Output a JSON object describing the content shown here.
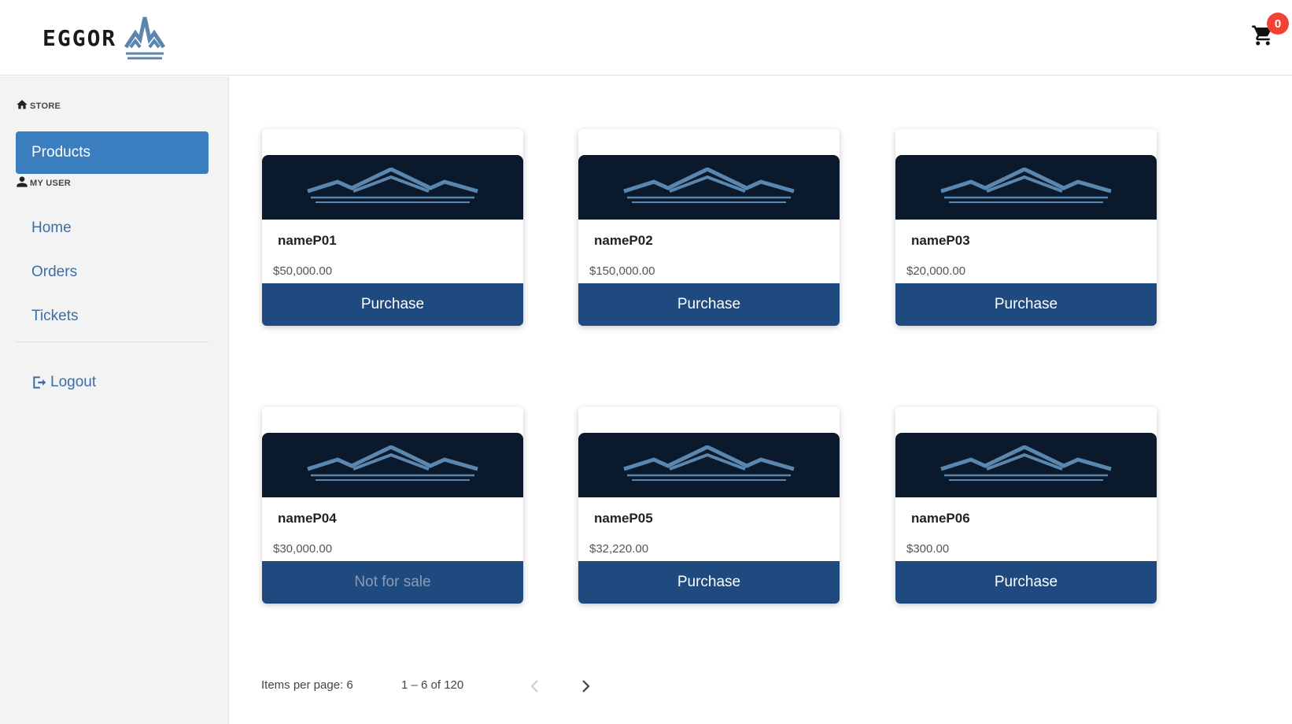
{
  "header": {
    "logo_text": "EGGOR",
    "cart_count": "0"
  },
  "sidebar": {
    "store_heading": "STORE",
    "products_label": "Products",
    "my_user_heading": "MY USER",
    "home_label": "Home",
    "orders_label": "Orders",
    "tickets_label": "Tickets",
    "logout_label": "Logout"
  },
  "products": [
    {
      "name": "nameP01",
      "price": "$50,000.00",
      "action": "Purchase",
      "for_sale": true
    },
    {
      "name": "nameP02",
      "price": "$150,000.00",
      "action": "Purchase",
      "for_sale": true
    },
    {
      "name": "nameP03",
      "price": "$20,000.00",
      "action": "Purchase",
      "for_sale": true
    },
    {
      "name": "nameP04",
      "price": "$30,000.00",
      "action": "Not for sale",
      "for_sale": false
    },
    {
      "name": "nameP05",
      "price": "$32,220.00",
      "action": "Purchase",
      "for_sale": true
    },
    {
      "name": "nameP06",
      "price": "$300.00",
      "action": "Purchase",
      "for_sale": true
    }
  ],
  "paginator": {
    "items_per_page": "Items per page: 6",
    "range": "1 – 6 of 120"
  },
  "colors": {
    "accent": "#3a7ebf",
    "button": "#1f4a80",
    "badge": "#f44336"
  }
}
